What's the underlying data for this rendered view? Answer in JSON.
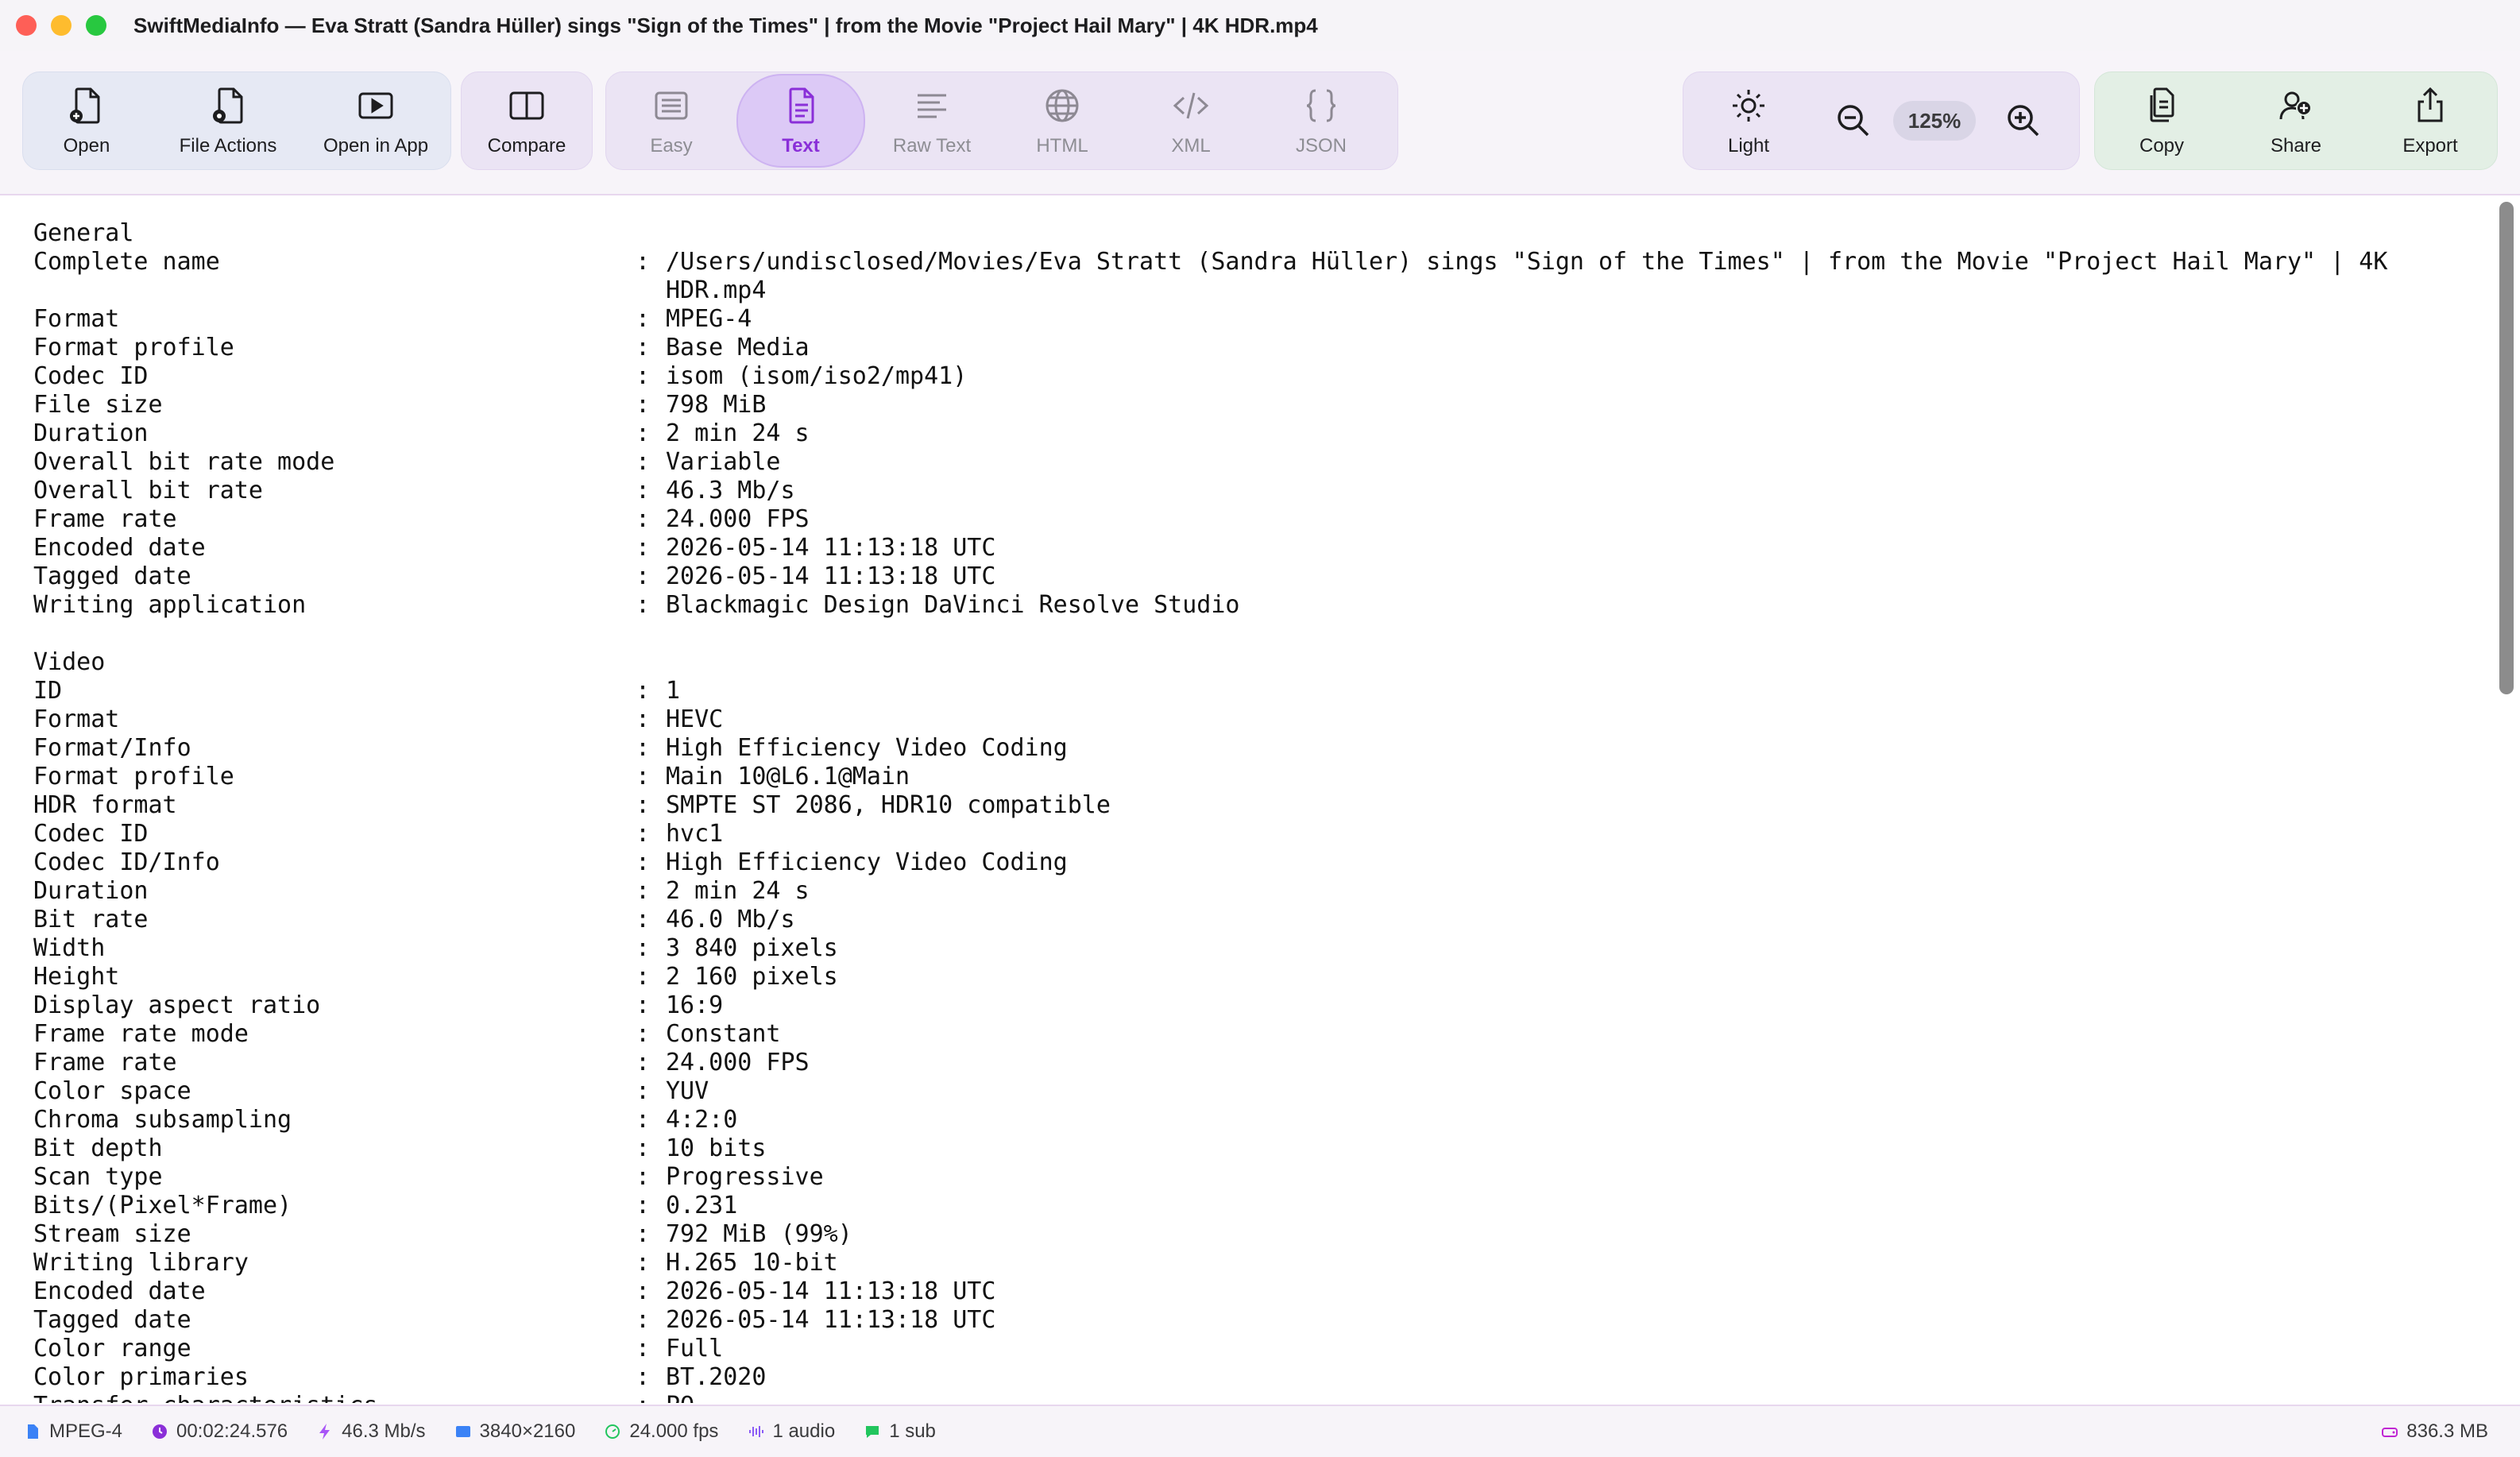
{
  "window": {
    "title": "SwiftMediaInfo — Eva Stratt (Sandra Hüller) sings \"Sign of the Times\" | from the Movie \"Project Hail Mary\" | 4K HDR.mp4"
  },
  "toolbar": {
    "open": "Open",
    "file_actions": "File Actions",
    "open_in_app": "Open in App",
    "compare": "Compare",
    "views": {
      "easy": "Easy",
      "text": "Text",
      "raw_text": "Raw Text",
      "html": "HTML",
      "xml": "XML",
      "json": "JSON"
    },
    "active_view": "Text",
    "theme": "Light",
    "zoom": "125%",
    "copy": "Copy",
    "share": "Share",
    "export": "Export"
  },
  "report": {
    "sections": [
      {
        "heading": "General",
        "rows": [
          {
            "label": "Complete name",
            "value": "/Users/undisclosed/Movies/Eva Stratt (Sandra Hüller) sings \"Sign of the Times\" | from the Movie \"Project Hail Mary\" | 4K HDR.mp4"
          },
          {
            "label": "Format",
            "value": "MPEG-4"
          },
          {
            "label": "Format profile",
            "value": "Base Media"
          },
          {
            "label": "Codec ID",
            "value": "isom (isom/iso2/mp41)"
          },
          {
            "label": "File size",
            "value": "798 MiB"
          },
          {
            "label": "Duration",
            "value": "2 min 24 s"
          },
          {
            "label": "Overall bit rate mode",
            "value": "Variable"
          },
          {
            "label": "Overall bit rate",
            "value": "46.3 Mb/s"
          },
          {
            "label": "Frame rate",
            "value": "24.000 FPS"
          },
          {
            "label": "Encoded date",
            "value": "2026-05-14 11:13:18 UTC"
          },
          {
            "label": "Tagged date",
            "value": "2026-05-14 11:13:18 UTC"
          },
          {
            "label": "Writing application",
            "value": "Blackmagic Design DaVinci Resolve Studio"
          }
        ]
      },
      {
        "heading": "Video",
        "rows": [
          {
            "label": "ID",
            "value": "1"
          },
          {
            "label": "Format",
            "value": "HEVC"
          },
          {
            "label": "Format/Info",
            "value": "High Efficiency Video Coding"
          },
          {
            "label": "Format profile",
            "value": "Main 10@L6.1@Main"
          },
          {
            "label": "HDR format",
            "value": "SMPTE ST 2086, HDR10 compatible"
          },
          {
            "label": "Codec ID",
            "value": "hvc1"
          },
          {
            "label": "Codec ID/Info",
            "value": "High Efficiency Video Coding"
          },
          {
            "label": "Duration",
            "value": "2 min 24 s"
          },
          {
            "label": "Bit rate",
            "value": "46.0 Mb/s"
          },
          {
            "label": "Width",
            "value": "3 840 pixels"
          },
          {
            "label": "Height",
            "value": "2 160 pixels"
          },
          {
            "label": "Display aspect ratio",
            "value": "16:9"
          },
          {
            "label": "Frame rate mode",
            "value": "Constant"
          },
          {
            "label": "Frame rate",
            "value": "24.000 FPS"
          },
          {
            "label": "Color space",
            "value": "YUV"
          },
          {
            "label": "Chroma subsampling",
            "value": "4:2:0"
          },
          {
            "label": "Bit depth",
            "value": "10 bits"
          },
          {
            "label": "Scan type",
            "value": "Progressive"
          },
          {
            "label": "Bits/(Pixel*Frame)",
            "value": "0.231"
          },
          {
            "label": "Stream size",
            "value": "792 MiB (99%)"
          },
          {
            "label": "Writing library",
            "value": "H.265 10-bit"
          },
          {
            "label": "Encoded date",
            "value": "2026-05-14 11:13:18 UTC"
          },
          {
            "label": "Tagged date",
            "value": "2026-05-14 11:13:18 UTC"
          },
          {
            "label": "Color range",
            "value": "Full"
          },
          {
            "label": "Color primaries",
            "value": "BT.2020"
          },
          {
            "label": "Transfer characteristics",
            "value": "PQ"
          }
        ]
      }
    ]
  },
  "status": {
    "format": "MPEG-4",
    "duration": "00:02:24.576",
    "bitrate": "46.3 Mb/s",
    "resolution": "3840×2160",
    "fps": "24.000 fps",
    "audio": "1 audio",
    "subs": "1 sub",
    "size": "836.3 MB"
  },
  "colors": {
    "accent": "#8a2fd8",
    "active_bg": "#dcc9f6",
    "toolbar_bg": "#f7f4f9"
  },
  "icons": {
    "open": "doc-plus-icon",
    "file_actions": "doc-gear-icon",
    "open_in_app": "play-rectangle-icon",
    "compare": "split-view-icon",
    "easy": "list-rectangle-icon",
    "text": "doc-text-icon",
    "raw_text": "text-lines-icon",
    "html": "globe-icon",
    "xml": "code-brackets-icon",
    "json": "curly-braces-icon",
    "theme": "sun-icon",
    "zoom_out": "magnifier-minus-icon",
    "zoom_in": "magnifier-plus-icon",
    "copy": "copy-docs-icon",
    "share": "share-people-icon",
    "export": "share-up-icon"
  }
}
